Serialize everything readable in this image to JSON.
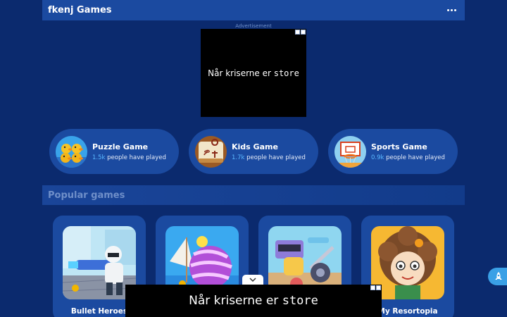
{
  "header": {
    "title": "fkenj Games",
    "menu_icon": "more-dots-icon"
  },
  "ad_top": {
    "label": "Advertisement",
    "text_main": "Når kriserne er ",
    "text_mono": "store"
  },
  "categories": [
    {
      "name": "Puzzle Game",
      "count": "1.5k",
      "suffix": " people have played",
      "icon": "ducks-icon"
    },
    {
      "name": "Kids Game",
      "count": "1.7k",
      "suffix": " people have played",
      "icon": "mahjong-tile-icon"
    },
    {
      "name": "Sports Game",
      "count": "0.9k",
      "suffix": " people have played",
      "icon": "basketball-hoop-icon"
    }
  ],
  "popular": {
    "title": "Popular games"
  },
  "games": [
    {
      "name": "Bullet Heroes"
    },
    {
      "name": ""
    },
    {
      "name": ""
    },
    {
      "name": "My Resortopia"
    }
  ],
  "ad_bottom": {
    "text_main": "Når kriserne er ",
    "text_mono": "store"
  },
  "colors": {
    "background": "#0b2a6e",
    "panel": "#1b4aa0",
    "accent": "#5ab8ff",
    "muted": "#6f8fc9"
  }
}
